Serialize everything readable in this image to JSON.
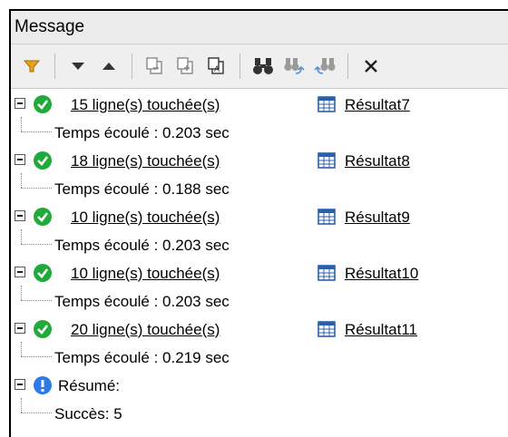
{
  "title": "Message",
  "toolbar": {
    "icons": [
      "filter-icon",
      "next-icon",
      "previous-icon",
      "copy-selected-icon",
      "copy-all-icon",
      "copy-icon",
      "find-icon",
      "find-next-icon",
      "find-previous-icon",
      "close-icon"
    ]
  },
  "colors": {
    "success": "#1faa3a",
    "info": "#2e7be6",
    "filter": "#e8a21a",
    "grid": "#2d5fa8"
  },
  "results": [
    {
      "message": "15 ligne(s) touchée(s)",
      "result": "Résultat7",
      "time": "Temps écoulé : 0.203 sec"
    },
    {
      "message": "18 ligne(s) touchée(s)",
      "result": "Résultat8",
      "time": "Temps écoulé : 0.188 sec"
    },
    {
      "message": "10 ligne(s) touchée(s)",
      "result": "Résultat9",
      "time": "Temps écoulé : 0.203 sec"
    },
    {
      "message": "10 ligne(s) touchée(s)",
      "result": "Résultat10",
      "time": "Temps écoulé : 0.203 sec"
    },
    {
      "message": "20 ligne(s) touchée(s)",
      "result": "Résultat11",
      "time": "Temps écoulé : 0.219 sec"
    }
  ],
  "summary": {
    "label": "Résumé:",
    "detail": "Succès: 5"
  }
}
